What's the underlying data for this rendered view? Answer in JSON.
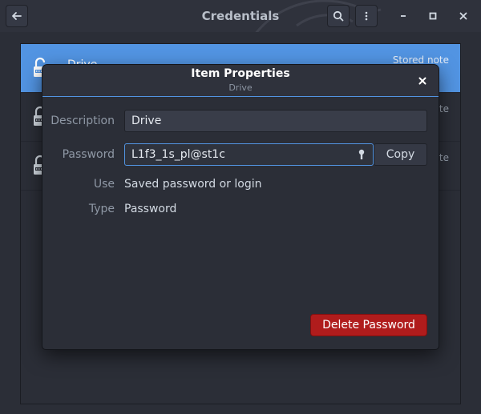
{
  "window": {
    "title": "Credentials"
  },
  "list": {
    "items": [
      {
        "name": "Drive",
        "kind": "Stored note",
        "selected": true
      },
      {
        "name": "",
        "kind": "Stored note",
        "selected": false
      },
      {
        "name": "",
        "kind": "Stored note",
        "selected": false
      }
    ]
  },
  "dialog": {
    "title": "Item Properties",
    "subtitle": "Drive",
    "description_label": "Description",
    "description_value": "Drive",
    "password_label": "Password",
    "password_value": "L1f3_1s_pl@st1c",
    "copy_label": "Copy",
    "use_label": "Use",
    "use_value": "Saved password or login",
    "type_label": "Type",
    "type_value": "Password",
    "delete_label": "Delete Password"
  },
  "icons": {
    "back": "back-arrow-icon",
    "search": "search-icon",
    "menu": "kebab-menu-icon",
    "minimize": "minimize-icon",
    "maximize": "maximize-icon",
    "close": "close-icon",
    "item": "lock-icon",
    "reveal": "key-icon"
  },
  "colors": {
    "accent": "#5294e2",
    "destructive": "#b01c1c",
    "background": "#2b2e37"
  }
}
